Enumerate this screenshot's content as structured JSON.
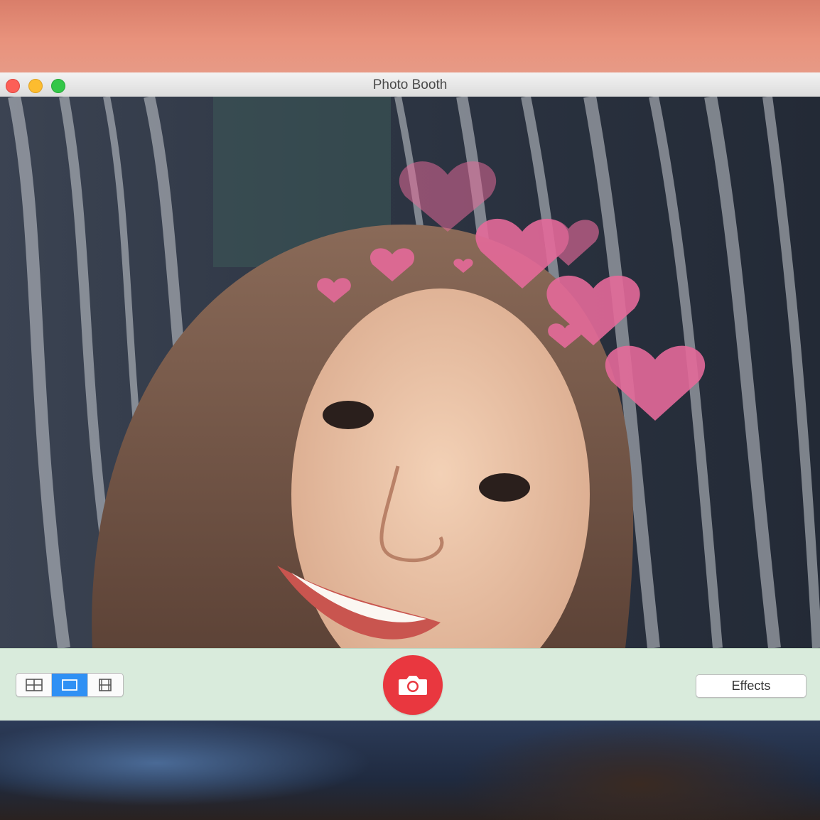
{
  "window": {
    "title": "Photo Booth"
  },
  "toolbar": {
    "layout_options": [
      {
        "icon": "grid-four-icon",
        "selected": false
      },
      {
        "icon": "single-photo-icon",
        "selected": true
      },
      {
        "icon": "filmstrip-icon",
        "selected": false
      }
    ],
    "shutter_icon": "camera-icon",
    "effects_label": "Effects"
  },
  "colors": {
    "shutter": "#e9373f",
    "selected_segment": "#2f90f4",
    "toolbar_bg": "#d9ebdc"
  }
}
